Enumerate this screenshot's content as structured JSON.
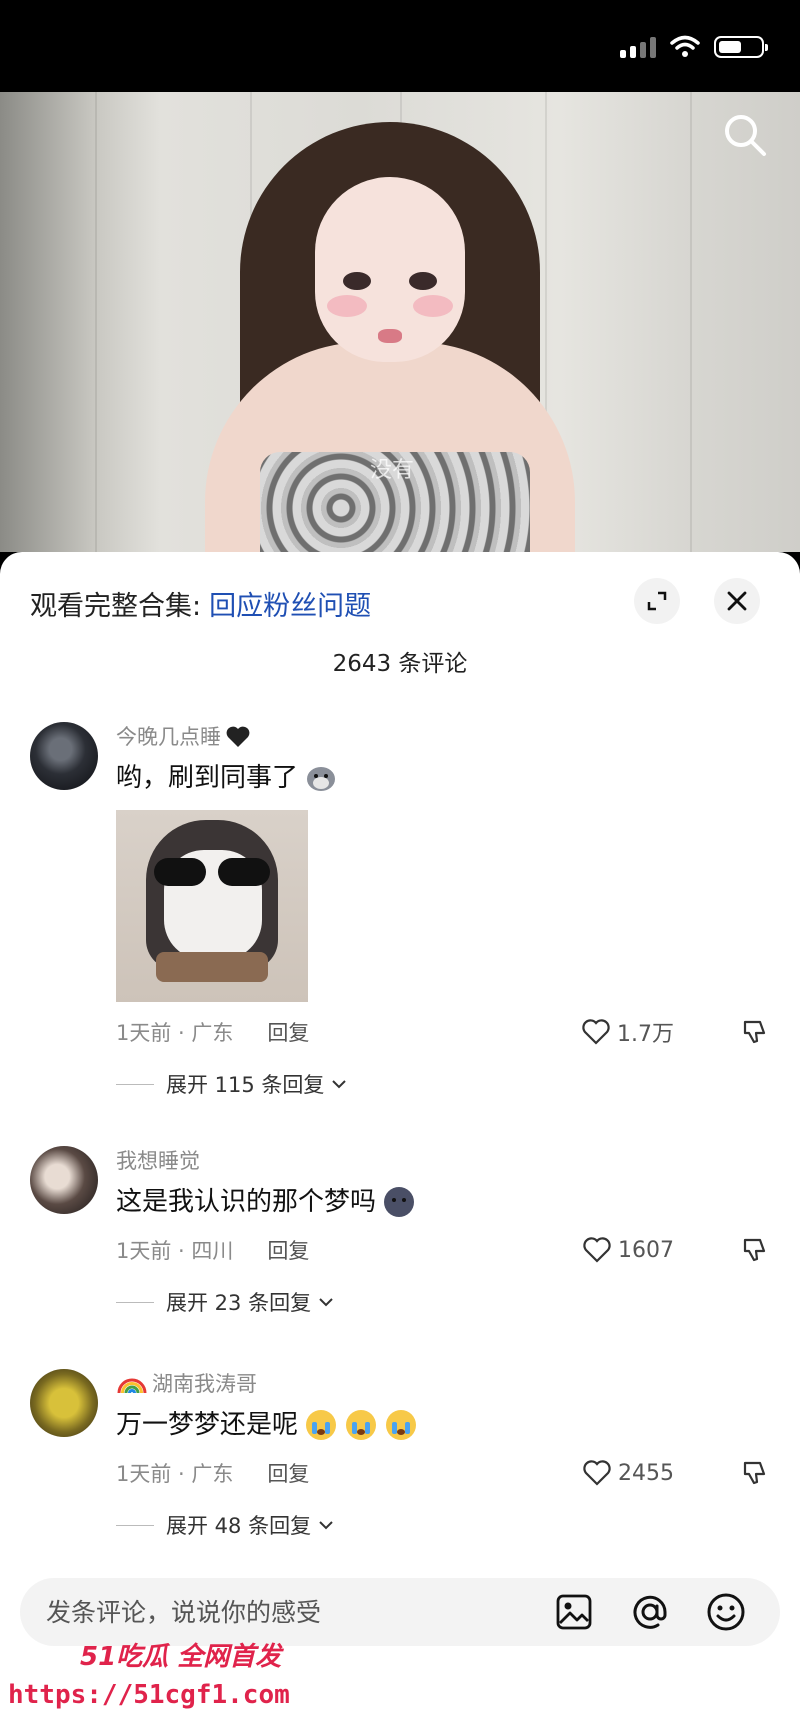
{
  "header": {
    "collection_label": "观看完整合集:",
    "collection_link": "回应粉丝问题",
    "comment_count": "2643 条评论"
  },
  "video": {
    "caption": "没有"
  },
  "comments": [
    {
      "username": "今晚几点睡",
      "text": "哟，刷到同事了",
      "meta": "1天前 · 广东",
      "reply_label": "回复",
      "likes": "1.7万",
      "expand_label": "展开 115 条回复"
    },
    {
      "username": "我想睡觉",
      "text": "这是我认识的那个梦吗",
      "meta": "1天前 · 四川",
      "reply_label": "回复",
      "likes": "1607",
      "expand_label": "展开 23 条回复"
    },
    {
      "username": "湖南我涛哥",
      "text": "万一梦梦还是呢",
      "meta": "1天前 · 广东",
      "reply_label": "回复",
      "likes": "2455",
      "expand_label": "展开 48 条回复"
    }
  ],
  "input": {
    "placeholder": "发条评论，说说你的感受"
  },
  "watermark": {
    "brand": "51吃瓜 全网首发",
    "url": "https://51cgf1.com"
  },
  "colors": {
    "link": "#1f4fb3",
    "watermark": "#e0234b"
  }
}
